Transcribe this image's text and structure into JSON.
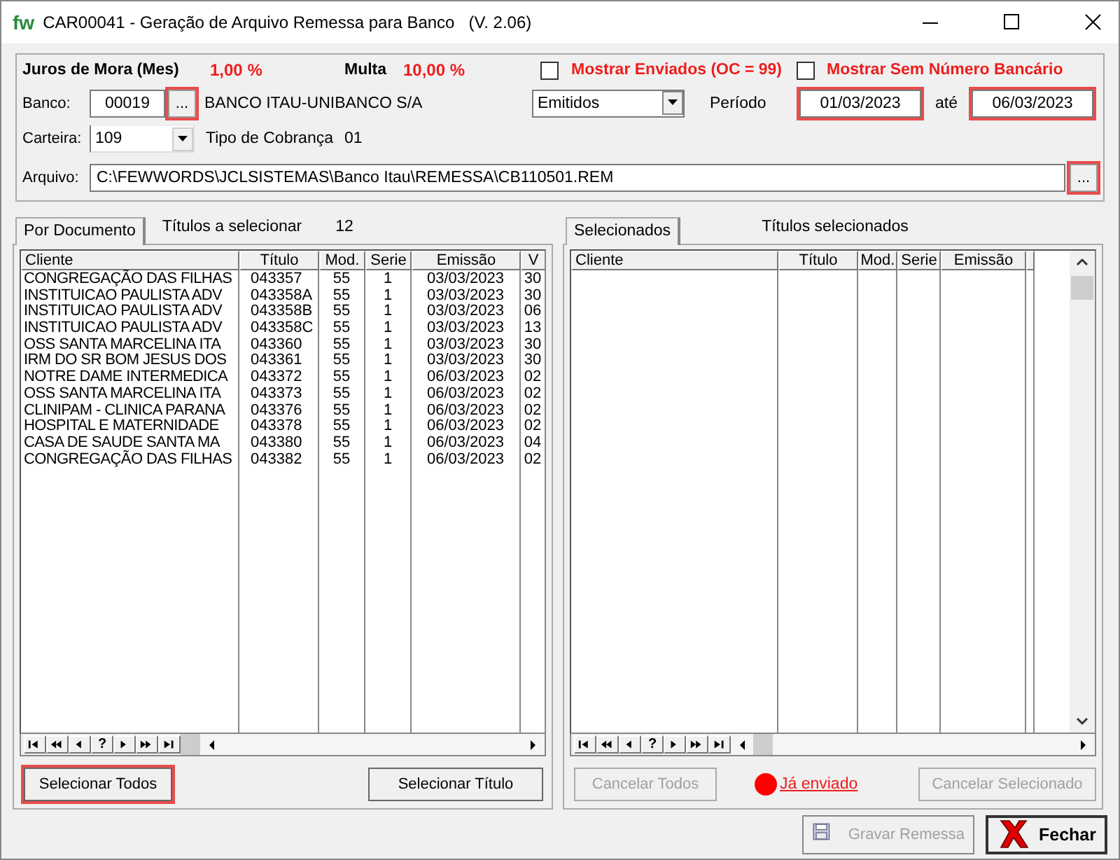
{
  "window": {
    "logo": "fw",
    "title": "CAR00041 - Geração de Arquivo Remessa para Banco",
    "version": "(V. 2.06)"
  },
  "filters": {
    "juros_label": "Juros de Mora (Mes)",
    "juros_value": "1,00 %",
    "multa_label": "Multa",
    "multa_value": "10,00 %",
    "checkboxes": [
      {
        "label": "Mostrar Enviados (OC = 99)",
        "checked": false
      },
      {
        "label": "Mostrar Sem Número Bancário",
        "checked": false
      }
    ],
    "banco": {
      "label": "Banco:",
      "code": "00019",
      "button": {
        "label": "...",
        "highlighted": true
      },
      "name": "BANCO ITAU-UNIBANCO S/A"
    },
    "status_combo": {
      "value": "Emitidos"
    },
    "periodo": {
      "label": "Período",
      "from": {
        "value": "01/03/2023",
        "highlighted": true
      },
      "to_label": "até",
      "to": {
        "value": "06/03/2023",
        "highlighted": true
      }
    },
    "carteira": {
      "label": "Carteira:",
      "value": "109",
      "tipo_label": "Tipo de Cobrança",
      "tipo_value": "01"
    },
    "arquivo": {
      "label": "Arquivo:",
      "value": "C:\\FEWWORDS\\JCLSISTEMAS\\Banco Itau\\REMESSA\\CB110501.REM",
      "button": {
        "label": "...",
        "highlighted": true
      }
    }
  },
  "panels": [
    {
      "tab": {
        "label": "Por Documento",
        "selected": true
      },
      "caption": "Títulos a selecionar",
      "count": "12",
      "table": {
        "columns": [
          "Cliente",
          "Título",
          "Mod.",
          "Serie",
          "Emissão",
          "V"
        ],
        "rows": [
          {
            "cliente": "CONGREGAÇÃO DAS FILHAS",
            "titulo": "043357",
            "mod": "55",
            "serie": "1",
            "emissao": "03/03/2023",
            "column_6": "30"
          },
          {
            "cliente": "INSTITUICAO PAULISTA ADV",
            "titulo": "043358",
            "parcela": "A",
            "mod": "55",
            "serie": "1",
            "emissao": "03/03/2023",
            "column_6": "30"
          },
          {
            "cliente": "INSTITUICAO PAULISTA ADV",
            "titulo": "043358",
            "parcela": "B",
            "mod": "55",
            "serie": "1",
            "emissao": "03/03/2023",
            "column_6": "06"
          },
          {
            "cliente": "INSTITUICAO PAULISTA ADV",
            "titulo": "043358",
            "parcela": "C",
            "mod": "55",
            "serie": "1",
            "emissao": "03/03/2023",
            "column_6": "13"
          },
          {
            "cliente": "OSS SANTA MARCELINA ITA",
            "titulo": "043360",
            "mod": "55",
            "serie": "1",
            "emissao": "03/03/2023",
            "column_6": "30"
          },
          {
            "cliente": "IRM DO SR BOM JESUS DOS",
            "titulo": "043361",
            "mod": "55",
            "serie": "1",
            "emissao": "03/03/2023",
            "column_6": "30"
          },
          {
            "cliente": "NOTRE DAME INTERMEDICA",
            "titulo": "043372",
            "mod": "55",
            "serie": "1",
            "emissao": "06/03/2023",
            "column_6": "02"
          },
          {
            "cliente": "OSS SANTA MARCELINA ITA",
            "titulo": "043373",
            "mod": "55",
            "serie": "1",
            "emissao": "06/03/2023",
            "column_6": "02"
          },
          {
            "cliente": "CLINIPAM - CLINICA PARANA",
            "titulo": "043376",
            "mod": "55",
            "serie": "1",
            "emissao": "06/03/2023",
            "column_6": "02"
          },
          {
            "cliente": "HOSPITAL E MATERNIDADE",
            "titulo": "043378",
            "mod": "55",
            "serie": "1",
            "emissao": "06/03/2023",
            "column_6": "02"
          },
          {
            "cliente": "CASA DE SAUDE SANTA MA",
            "titulo": "043380",
            "mod": "55",
            "serie": "1",
            "emissao": "06/03/2023",
            "column_6": "04"
          },
          {
            "cliente": "CONGREGAÇÃO DAS FILHAS",
            "titulo": "043382",
            "mod": "55",
            "serie": "1",
            "emissao": "06/03/2023",
            "column_6": "02"
          }
        ]
      },
      "navigator_label": "?",
      "buttons": [
        {
          "label": "Selecionar Todos",
          "disabled": false,
          "highlighted": true
        },
        {
          "label": "Selecionar Título",
          "disabled": false,
          "highlighted": false
        }
      ]
    },
    {
      "tab": {
        "label": "Selecionados",
        "selected": true
      },
      "caption": "Títulos selecionados",
      "table": {
        "columns": [
          "Cliente",
          "Título",
          "Mod.",
          "Serie",
          "Emissão"
        ]
      },
      "navigator_label": "?",
      "buttons": [
        {
          "label": "Cancelar Todos",
          "disabled": true,
          "highlighted": false
        },
        {
          "label": "Cancelar Selecionado",
          "disabled": true,
          "highlighted": false
        }
      ],
      "legend": {
        "label": "Já enviado",
        "color": "#ff0000"
      }
    }
  ],
  "footer_buttons": [
    {
      "kind": "save",
      "label": "Gravar Remessa",
      "disabled": true
    },
    {
      "kind": "close",
      "label": "Fechar",
      "disabled": false
    }
  ]
}
